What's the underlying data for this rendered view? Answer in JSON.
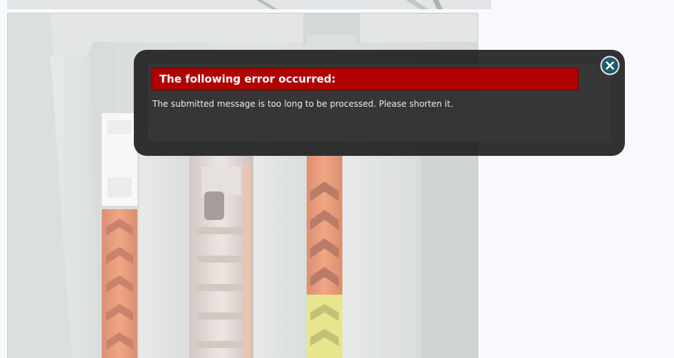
{
  "dialog": {
    "title": "The following error occurred:",
    "message": "The submitted message is too long to be processed. Please shorten it.",
    "close_icon": "close-circle-icon"
  },
  "colors": {
    "page_background": "#f7f9fd",
    "overlay": "#121212",
    "error_header": "#b00000",
    "close_button": "#1f5a6d"
  }
}
